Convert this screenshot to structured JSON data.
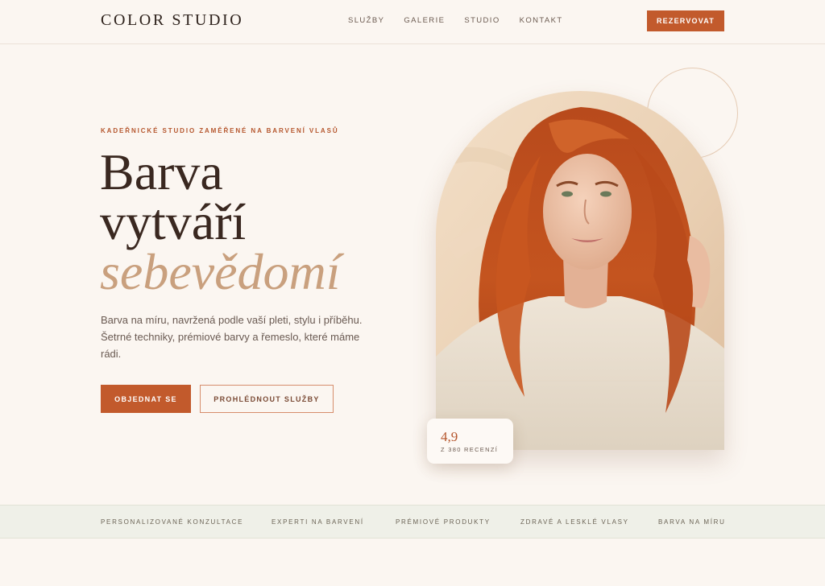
{
  "header": {
    "logo": "COLOR STUDIO",
    "nav": [
      "SLUŽBY",
      "GALERIE",
      "STUDIO",
      "KONTAKT"
    ],
    "cta": "REZERVOVAT"
  },
  "hero": {
    "eyebrow": "KADEŘNICKÉ STUDIO ZAMĚŘENÉ NA BARVENÍ VLASŮ",
    "title_line1": "Barva",
    "title_line2": "vytváří",
    "title_accent": "sebevědomí",
    "desc_line1": "Barva na míru, navržená podle vaší pleti, stylu i příběhu.",
    "desc_line2": "Šetrné techniky, prémiové barvy a řemeslo, které máme",
    "desc_line3": "rádi.",
    "primary_button": "OBJEDNAT SE",
    "secondary_button": "PROHLÉDNOUT SLUŽBY"
  },
  "rating": {
    "value": "4,9",
    "label": "Z 380 RECENZÍ"
  },
  "features": [
    "PERSONALIZOVANÉ KONZULTACE",
    "EXPERTI NA BARVENÍ",
    "PRÉMIOVÉ PRODUKTY",
    "ZDRAVÉ A LESKLÉ VLASY",
    "BARVA NA MÍRU"
  ],
  "colors": {
    "accent": "#c25a2c",
    "accent_soft": "#c9a07e",
    "background": "#fbf6f1",
    "strip": "#eff0e8"
  }
}
